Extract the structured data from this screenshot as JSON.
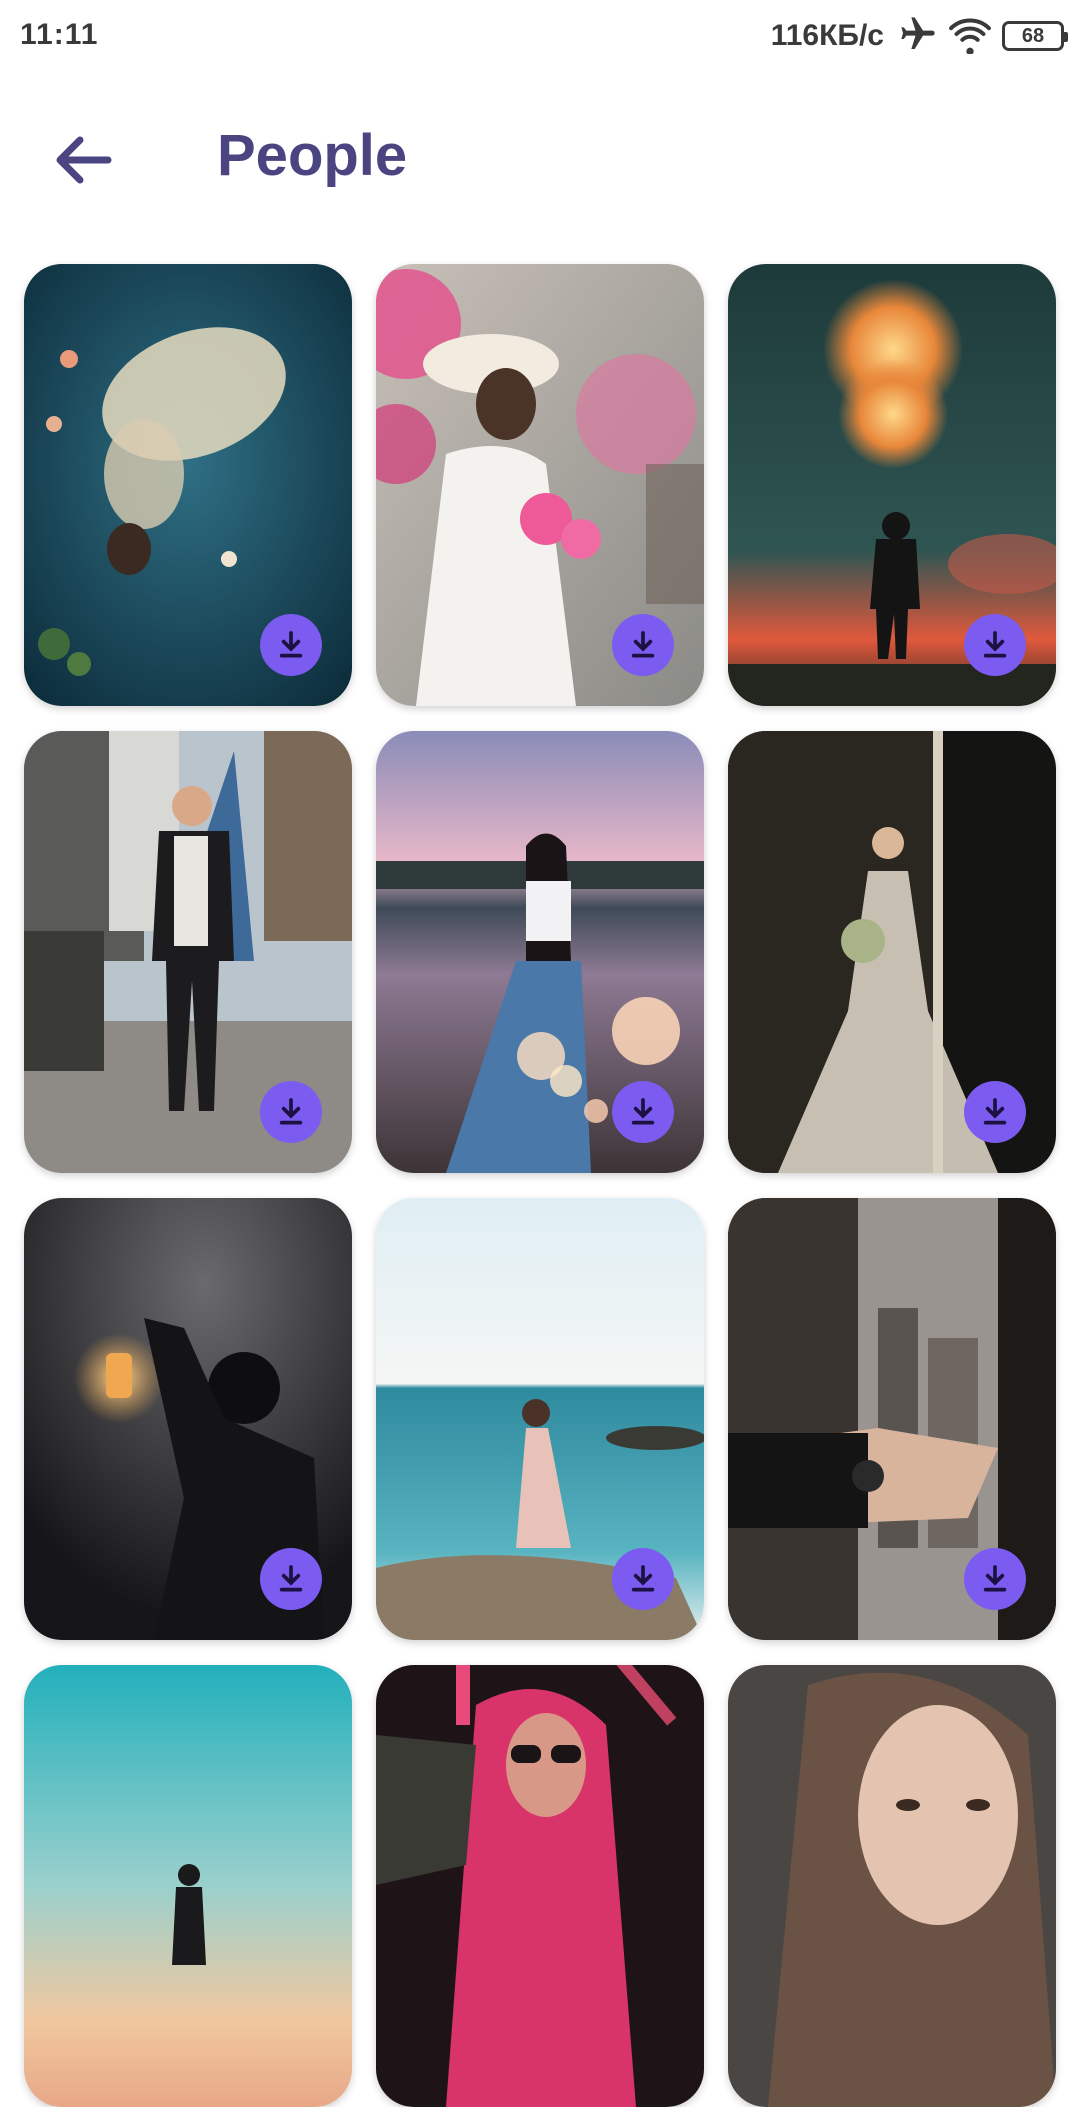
{
  "status_bar": {
    "time": "11:11",
    "net_speed": "116КБ/с",
    "battery": "68",
    "icons": [
      "airplane-icon",
      "wifi-icon",
      "battery-icon"
    ]
  },
  "header": {
    "title": "People",
    "back_icon": "arrow-left-icon"
  },
  "colors": {
    "title": "#4a4580",
    "accent": "#7c5cf0"
  },
  "gallery": {
    "items": [
      {
        "subject": "woman floating in water",
        "has_download": true
      },
      {
        "subject": "girl with hat and pink flowers",
        "has_download": true
      },
      {
        "subject": "man under fireworks",
        "has_download": true
      },
      {
        "subject": "man with camera on city street",
        "has_download": true
      },
      {
        "subject": "woman by lake at sunset",
        "has_download": true
      },
      {
        "subject": "bride in dark doorway",
        "has_download": true
      },
      {
        "subject": "man holding lantern",
        "has_download": true
      },
      {
        "subject": "woman on rock by the sea",
        "has_download": true
      },
      {
        "subject": "hand with watch at window",
        "has_download": true
      },
      {
        "subject": "silhouette under teal sky",
        "has_download": false
      },
      {
        "subject": "woman with red hair and sunglasses",
        "has_download": false
      },
      {
        "subject": "woman portrait",
        "has_download": false
      }
    ],
    "download_icon": "download-icon"
  }
}
